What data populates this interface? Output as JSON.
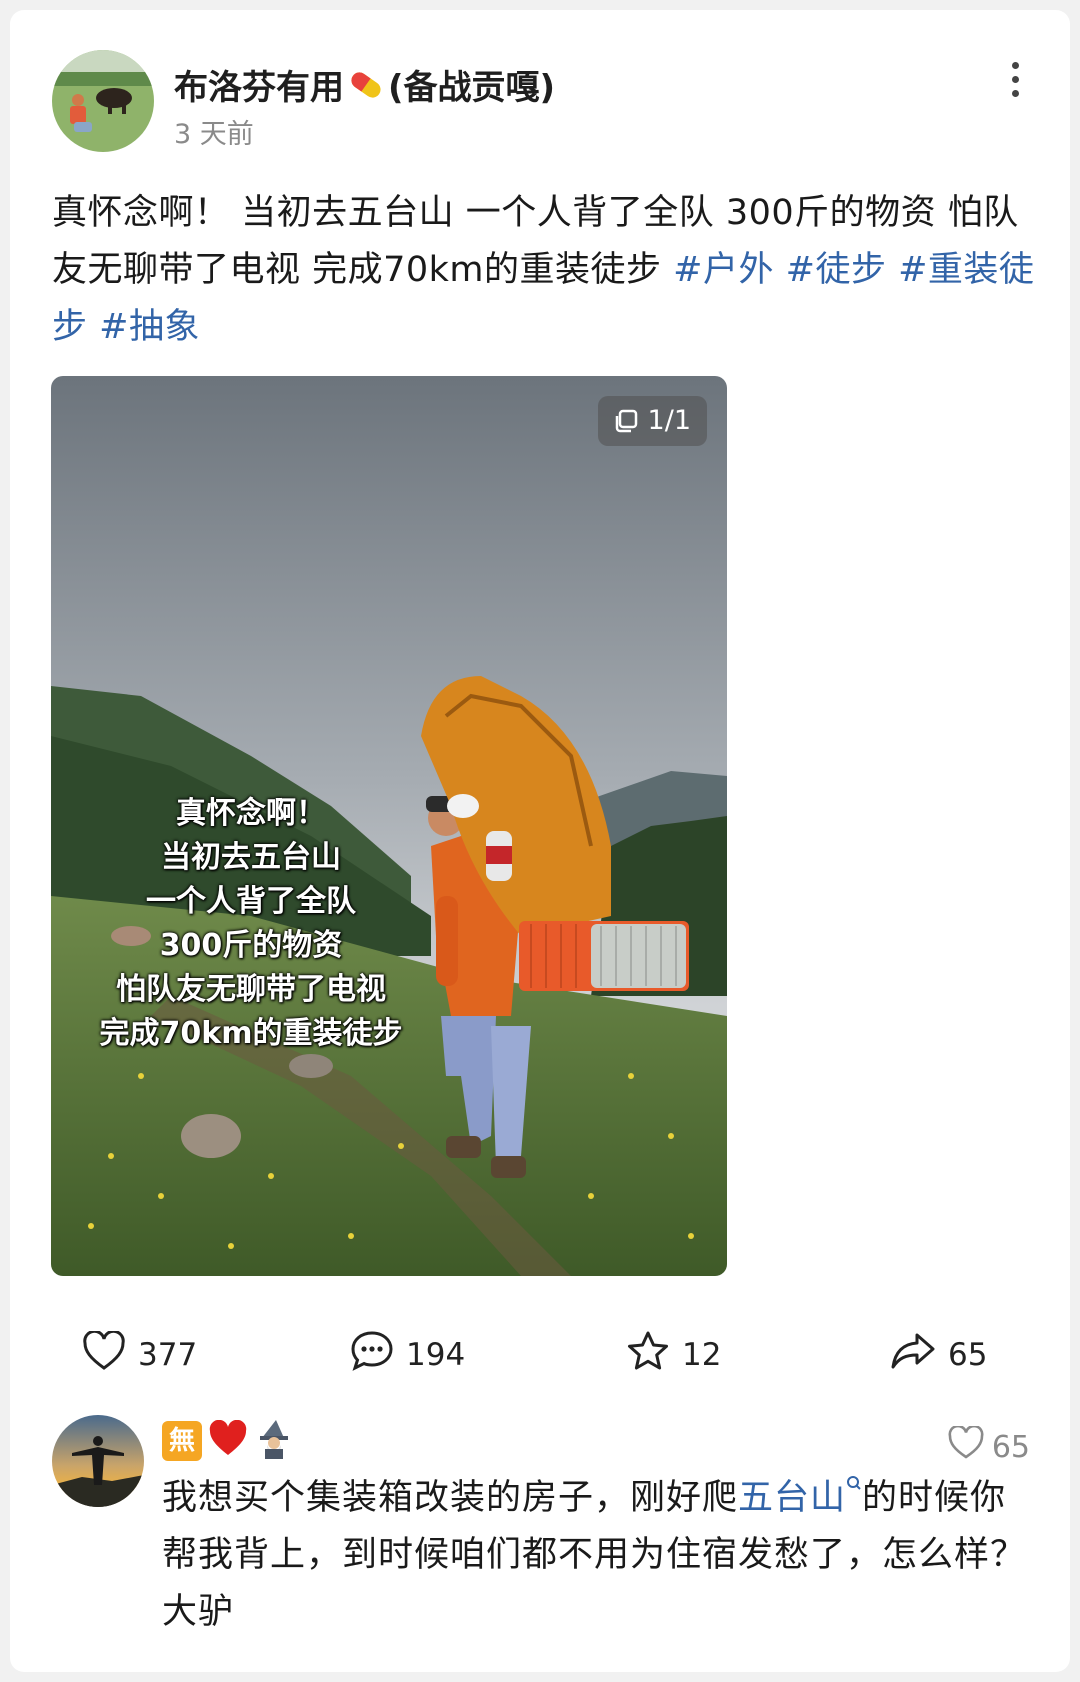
{
  "post": {
    "author": "布洛芬有用",
    "author_suffix": "(备战贡嘎)",
    "time": "3 天前",
    "text_main": "真怀念啊！ 当初去五台山 一个人背了全队 300斤的物资 怕队友无聊带了电视 完成70km的重装徒步 ",
    "tags": [
      "#户外",
      "#徒步",
      "#重装徒步",
      "#抽象"
    ],
    "image_counter": "1/1",
    "image_caption_lines": [
      "真怀念啊！",
      "当初去五台山",
      "一个人背了全队",
      "300斤的物资",
      "怕队友无聊带了电视",
      "完成70km的重装徒步"
    ]
  },
  "actions": {
    "likes": "377",
    "comments": "194",
    "favorites": "12",
    "shares": "65"
  },
  "comment": {
    "badge_text": "無",
    "likes": "65",
    "text_before_link": "我想买个集装箱改装的房子，刚好爬",
    "link_text": "五台山",
    "text_after_link": "的时候你帮我背上，到时候咱们都不用为住宿发愁了，怎么样？大驴"
  },
  "colors": {
    "tag_blue": "#3264a8",
    "time_gray": "#8a8a8a",
    "card_bg": "#ffffff",
    "page_bg": "#f1f1f1"
  },
  "icons": [
    "more-vertical-icon",
    "pill-emoji",
    "gallery-icon",
    "heart-icon",
    "comment-icon",
    "star-icon",
    "share-icon",
    "heart-emoji",
    "wizard-emoji",
    "search-icon"
  ]
}
